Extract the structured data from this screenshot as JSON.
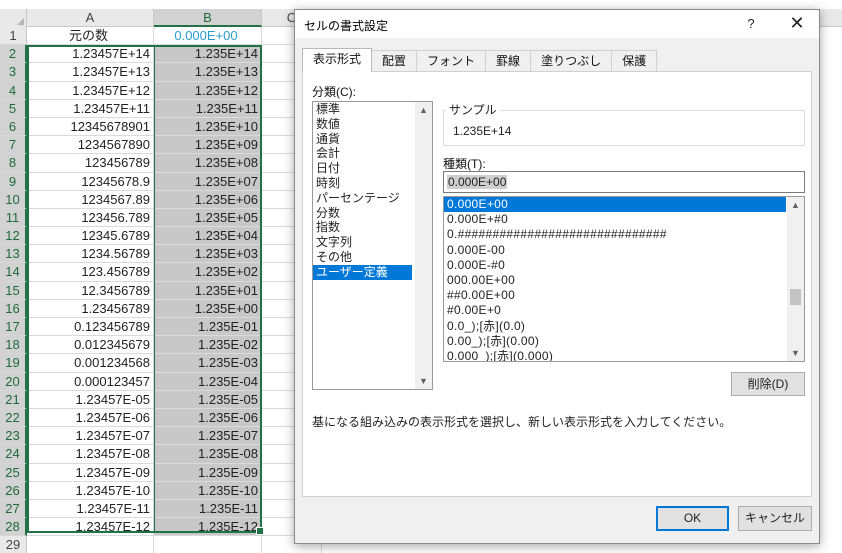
{
  "spreadsheet": {
    "columns": [
      "A",
      "B",
      "C"
    ],
    "header_row": {
      "num": "1",
      "a": "元の数",
      "b": "0.000E+00"
    },
    "rows": [
      {
        "num": "2",
        "a": "1.23457E+14",
        "b": "1.235E+14"
      },
      {
        "num": "3",
        "a": "1.23457E+13",
        "b": "1.235E+13"
      },
      {
        "num": "4",
        "a": "1.23457E+12",
        "b": "1.235E+12"
      },
      {
        "num": "5",
        "a": "1.23457E+11",
        "b": "1.235E+11"
      },
      {
        "num": "6",
        "a": "12345678901",
        "b": "1.235E+10"
      },
      {
        "num": "7",
        "a": "1234567890",
        "b": "1.235E+09"
      },
      {
        "num": "8",
        "a": "123456789",
        "b": "1.235E+08"
      },
      {
        "num": "9",
        "a": "12345678.9",
        "b": "1.235E+07"
      },
      {
        "num": "10",
        "a": "1234567.89",
        "b": "1.235E+06"
      },
      {
        "num": "11",
        "a": "123456.789",
        "b": "1.235E+05"
      },
      {
        "num": "12",
        "a": "12345.6789",
        "b": "1.235E+04"
      },
      {
        "num": "13",
        "a": "1234.56789",
        "b": "1.235E+03"
      },
      {
        "num": "14",
        "a": "123.456789",
        "b": "1.235E+02"
      },
      {
        "num": "15",
        "a": "12.3456789",
        "b": "1.235E+01"
      },
      {
        "num": "16",
        "a": "1.23456789",
        "b": "1.235E+00"
      },
      {
        "num": "17",
        "a": "0.123456789",
        "b": "1.235E-01"
      },
      {
        "num": "18",
        "a": "0.012345679",
        "b": "1.235E-02"
      },
      {
        "num": "19",
        "a": "0.001234568",
        "b": "1.235E-03"
      },
      {
        "num": "20",
        "a": "0.000123457",
        "b": "1.235E-04"
      },
      {
        "num": "21",
        "a": "1.23457E-05",
        "b": "1.235E-05"
      },
      {
        "num": "22",
        "a": "1.23457E-06",
        "b": "1.235E-06"
      },
      {
        "num": "23",
        "a": "1.23457E-07",
        "b": "1.235E-07"
      },
      {
        "num": "24",
        "a": "1.23457E-08",
        "b": "1.235E-08"
      },
      {
        "num": "25",
        "a": "1.23457E-09",
        "b": "1.235E-09"
      },
      {
        "num": "26",
        "a": "1.23457E-10",
        "b": "1.235E-10"
      },
      {
        "num": "27",
        "a": "1.23457E-11",
        "b": "1.235E-11"
      },
      {
        "num": "28",
        "a": "1.23457E-12",
        "b": "1.235E-12"
      }
    ],
    "last_row_num": "29"
  },
  "dialog": {
    "title": "セルの書式設定",
    "help": "?",
    "close": "✕",
    "tabs": [
      "表示形式",
      "配置",
      "フォント",
      "罫線",
      "塗りつぶし",
      "保護"
    ],
    "category_label": "分類(C):",
    "category_label_key": "C",
    "categories": [
      "標準",
      "数値",
      "通貨",
      "会計",
      "日付",
      "時刻",
      "パーセンテージ",
      "分数",
      "指数",
      "文字列",
      "その他",
      "ユーザー定義"
    ],
    "selected_category": "ユーザー定義",
    "sample_label": "サンプル",
    "sample_value": "1.235E+14",
    "type_label": "種類(T):",
    "type_value": "0.000E+00",
    "formats": [
      "0.000E+00",
      "0.000E+#0",
      "0.##############################",
      "0.000E-00",
      "0.000E-#0",
      "000.00E+00",
      "##0.00E+00",
      "#0.00E+0",
      "0.0_);[赤](0.0)",
      "0.00_);[赤](0.00)",
      "0.000_);[赤](0.000)"
    ],
    "selected_format": "0.000E+00",
    "delete_button": "削除(D)",
    "description": "基になる組み込みの表示形式を選択し、新しい表示形式を入力してください。",
    "ok_button": "OK",
    "cancel_button": "キャンセル"
  },
  "colors": {
    "accent": "#0078d7",
    "excel_green": "#217346",
    "selected_fill": "#c8c8c8"
  }
}
